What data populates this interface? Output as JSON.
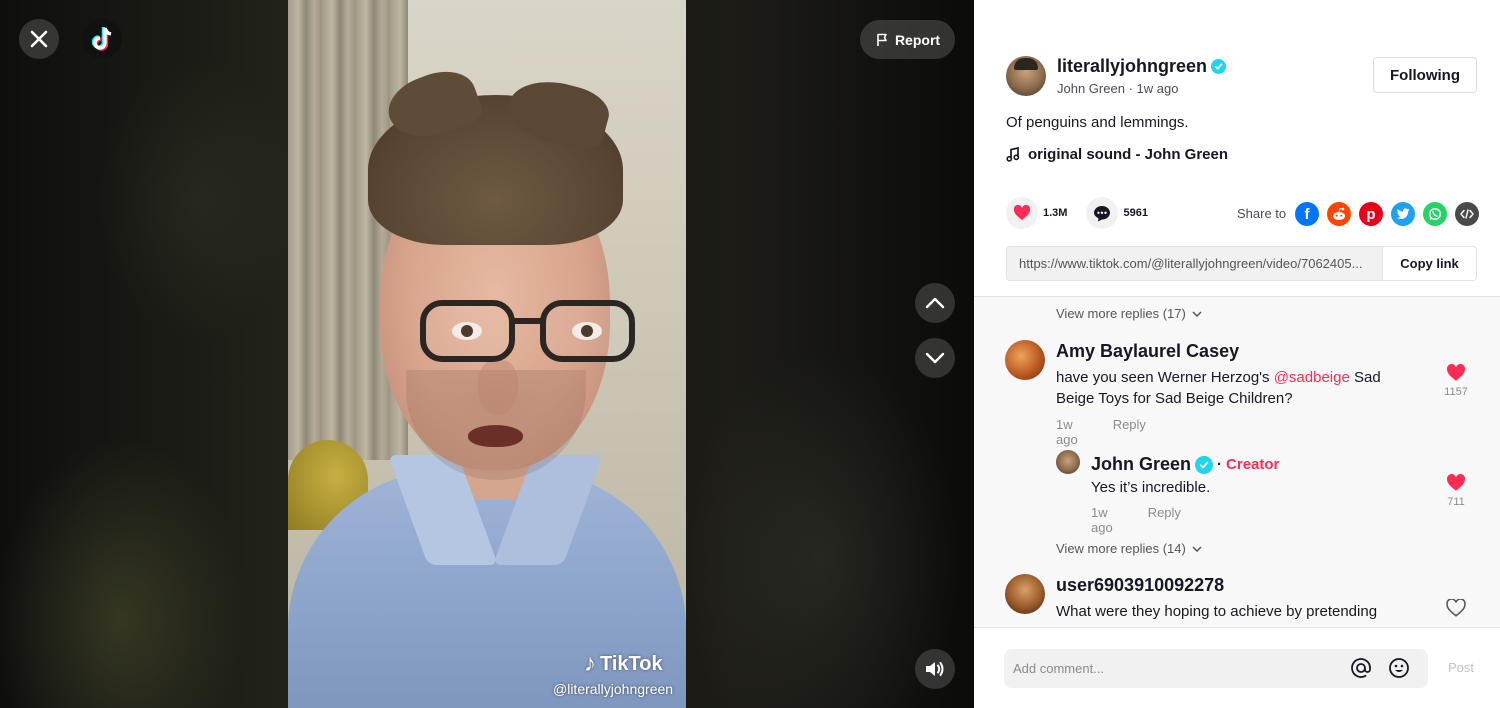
{
  "video": {
    "report_label": "Report",
    "watermark_brand": "TikTok",
    "watermark_handle": "@literallyjohngreen"
  },
  "icons": {
    "close": "close-icon",
    "logo": "tiktok-logo-icon",
    "report": "flag-icon",
    "prev": "chevron-up-icon",
    "next": "chevron-down-icon",
    "volume": "volume-icon"
  },
  "author": {
    "username": "literallyjohngreen",
    "verified": true,
    "display_name": "John Green",
    "time": "1w ago",
    "follow_label": "Following"
  },
  "post": {
    "caption": "Of penguins and lemmings.",
    "sound": "original sound - John Green",
    "likes": "1.3M",
    "comments": "5961",
    "share_label": "Share to",
    "share_targets": [
      "facebook",
      "reddit",
      "pinterest",
      "twitter",
      "whatsapp",
      "embed"
    ],
    "link": "https://www.tiktok.com/@literallyjohngreen/video/7062405...",
    "copy_label": "Copy link"
  },
  "comments": {
    "view_more_1": "View more replies (17)",
    "items": [
      {
        "name": "Amy Baylaurel Casey",
        "text_before": "have you seen Werner Herzog's ",
        "mention": "@sadbeige",
        "text_after": " Sad Beige Toys for Sad Beige Children?",
        "time": "1w ago",
        "reply_label": "Reply",
        "likes": "1157",
        "liked": true
      }
    ],
    "reply": {
      "name": "John Green",
      "badge": "Creator",
      "separator": "·",
      "text": "Yes it’s incredible.",
      "time": "1w ago",
      "reply_label": "Reply",
      "likes": "711",
      "liked": true
    },
    "view_more_2": "View more replies (14)",
    "third": {
      "name": "user6903910092278",
      "text": "What were they hoping to achieve by pretending",
      "liked": false
    }
  },
  "composer": {
    "placeholder": "Add comment...",
    "post_label": "Post"
  },
  "colors": {
    "accent": "#fe2c55",
    "verified": "#20d5ec",
    "facebook": "#0075fa",
    "reddit": "#ff4500",
    "pinterest": "#e60019",
    "twitter": "#1da1f2",
    "whatsapp": "#25d366",
    "embed": "#4a4a4a"
  }
}
